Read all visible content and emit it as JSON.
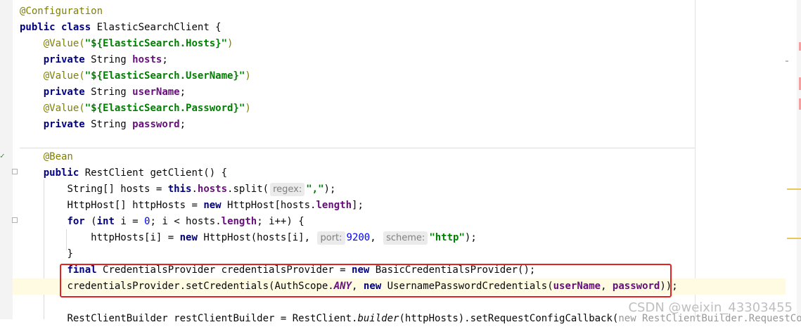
{
  "code": {
    "line1": "@Configuration",
    "line2_kw1": "public",
    "line2_kw2": "class",
    "line2_rest": " ElasticSearchClient {",
    "line3_ann": "@Value(",
    "line3_str": "\"${ElasticSearch.Hosts}\"",
    "line3_end": ")",
    "line4_kw": "private",
    "line4_type": " String ",
    "line4_fld": "hosts",
    "line4_end": ";",
    "line5_ann": "@Value(",
    "line5_str": "\"${ElasticSearch.UserName}\"",
    "line5_end": ")",
    "line6_kw": "private",
    "line6_type": " String ",
    "line6_fld": "userName",
    "line6_end": ";",
    "line7_ann": "@Value(",
    "line7_str": "\"${ElasticSearch.Password}\"",
    "line7_end": ")",
    "line8_kw": "private",
    "line8_type": " String ",
    "line8_fld": "password",
    "line8_end": ";",
    "line10": "@Bean",
    "line11_kw": "public",
    "line11_rest": " RestClient getClient() {",
    "line12_a": "String[] hosts = ",
    "line12_kw": "this",
    "line12_b": ".",
    "line12_fld": "hosts",
    "line12_c": ".split(",
    "line12_hint": "regex:",
    "line12_str": "\",\"",
    "line12_end": ");",
    "line13_a": "HttpHost[] httpHosts = ",
    "line13_kw": "new",
    "line13_b": " HttpHost[hosts.",
    "line13_fld": "length",
    "line13_end": "];",
    "line14_kw1": "for",
    "line14_a": " (",
    "line14_kw2": "int",
    "line14_b": " i = ",
    "line14_num": "0",
    "line14_c": "; i < hosts.",
    "line14_fld": "length",
    "line14_end": "; i++) {",
    "line15_a": "httpHosts[i] = ",
    "line15_kw": "new",
    "line15_b": " HttpHost(hosts[i],",
    "line15_hint1": "port:",
    "line15_num": "9200",
    "line15_c": ",",
    "line15_hint2": "scheme:",
    "line15_str": "\"http\"",
    "line15_end": ");",
    "line16": "}",
    "line17_kw1": "final",
    "line17_a": " CredentialsProvider credentialsProvider = ",
    "line17_kw2": "new",
    "line17_b": " BasicCredentialsProvider();",
    "line18_a": "credentialsProvider.setCredentials(AuthScope.",
    "line18_itfld": "ANY",
    "line18_b": ", ",
    "line18_kw": "new",
    "line18_c": " UsernamePasswordCredentials(",
    "line18_fld1": "userName",
    "line18_d": ", ",
    "line18_fld2": "password",
    "line18_end": "));",
    "line20_a": "RestClientBuilder restClientBuilder = RestClient.",
    "line20_ital": "builder",
    "line20_b": "(httpHosts).setRequestConfigCallback(",
    "line20_grey": "new RestClientBuilder.RequestConfigCa"
  },
  "watermark": "CSDN @weixin_43303455",
  "colors": {
    "keyword": "#000080",
    "annotation": "#808000",
    "string": "#008000",
    "field": "#660e7a",
    "number": "#0000ff",
    "highlight_box": "#e52222",
    "current_line": "#fefbe2"
  }
}
